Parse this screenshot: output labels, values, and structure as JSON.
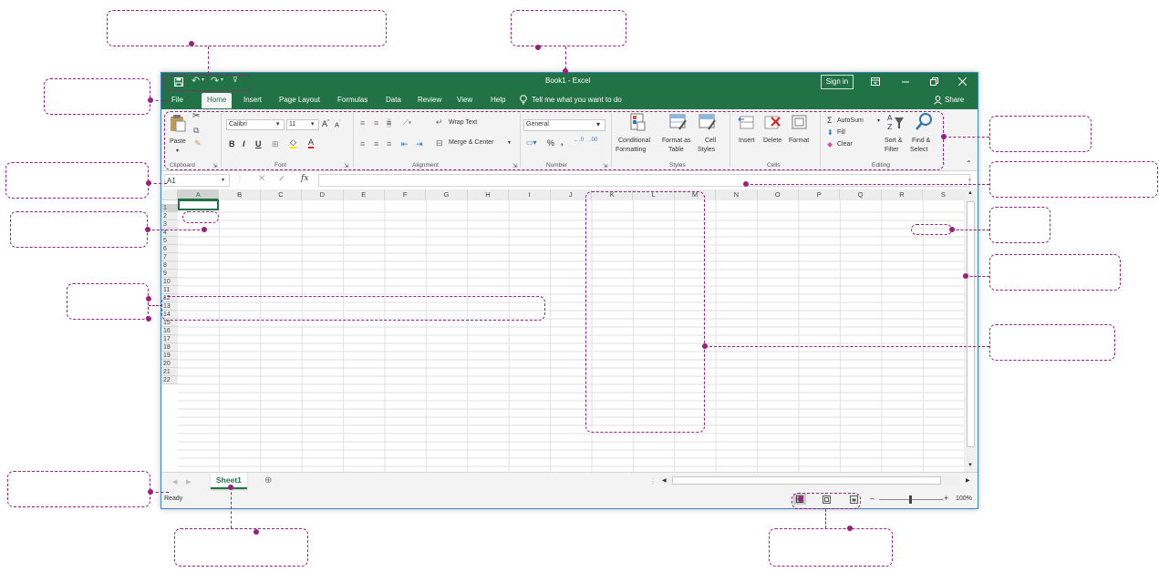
{
  "colors": {
    "accent": "#217346",
    "callout": "#9b1f7e",
    "window_border": "#3d86c6"
  },
  "window": {
    "title": "Book1  -  Excel",
    "sign_in": "Sign in",
    "share": "Share",
    "tell_me": "Tell me what you want to do"
  },
  "menu": [
    "File",
    "Home",
    "Insert",
    "Page Layout",
    "Formulas",
    "Data",
    "Review",
    "View",
    "Help"
  ],
  "ribbon": {
    "paste": "Paste",
    "clipboard": "Clipboard",
    "font_name": "Calibri",
    "font_size": "11",
    "font": "Font",
    "bold": "B",
    "italic": "I",
    "underline": "U",
    "wrap_text": "Wrap Text",
    "merge_center": "Merge & Center",
    "alignment": "Alignment",
    "number_format": "General",
    "number": "Number",
    "conditional_1": "Conditional",
    "conditional_2": "Formatting",
    "format_table_1": "Format as",
    "format_table_2": "Table",
    "cell_styles_1": "Cell",
    "cell_styles_2": "Styles",
    "styles": "Styles",
    "insert": "Insert",
    "delete": "Delete",
    "format": "Format",
    "cells": "Cells",
    "autosum": "AutoSum",
    "fill": "Fill",
    "clear": "Clear",
    "sort_1": "Sort &",
    "sort_2": "Filter",
    "find_1": "Find &",
    "find_2": "Select",
    "editing": "Editing"
  },
  "formula_bar": {
    "name_box": "A1",
    "fx": "fx",
    "value": ""
  },
  "columns": [
    "A",
    "B",
    "C",
    "D",
    "E",
    "F",
    "G",
    "H",
    "I",
    "J",
    "K",
    "L",
    "M",
    "N",
    "O",
    "P",
    "Q",
    "R",
    "S"
  ],
  "rows": [
    "1",
    "2",
    "3",
    "4",
    "5",
    "6",
    "7",
    "8",
    "9",
    "10",
    "11",
    "12",
    "13",
    "14",
    "15",
    "16",
    "17",
    "18",
    "19",
    "20",
    "21",
    "22"
  ],
  "sheet_tab": "Sheet1",
  "status": {
    "ready": "Ready",
    "zoom": "100%"
  }
}
